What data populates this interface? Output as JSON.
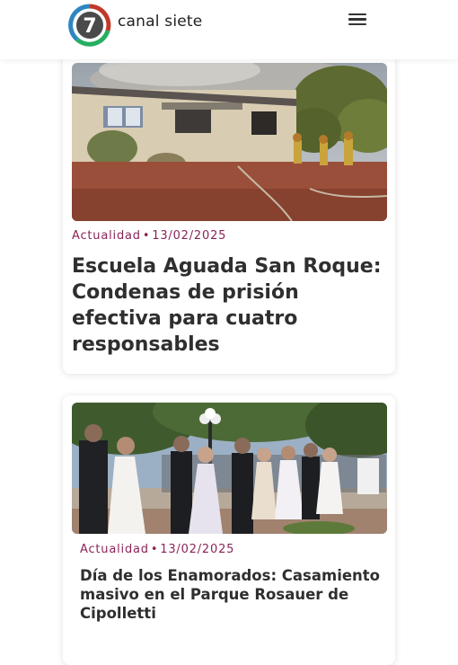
{
  "header": {
    "brand_name": "canal siete",
    "logo_text": "7",
    "logo_icon": "channel-7-logo",
    "menu_icon": "hamburger-menu-icon"
  },
  "articles": [
    {
      "category": "Actualidad",
      "separator": "•",
      "date": "13/02/2025",
      "title": "Escuela Aguada San Roque: Condenas de prisión efectiva para cuatro responsables"
    },
    {
      "category": "Actualidad",
      "separator": "•",
      "date": "13/02/2025",
      "title": "Día de los Enamorados: Casamiento masivo en el Parque Rosauer de Cipolletti"
    }
  ],
  "colors": {
    "meta_accent": "#8b2458",
    "title_text": "#2f2f2f",
    "logo_ring_red": "#c0392b",
    "logo_ring_green": "#27ae60",
    "logo_ring_blue": "#2e86c1"
  }
}
